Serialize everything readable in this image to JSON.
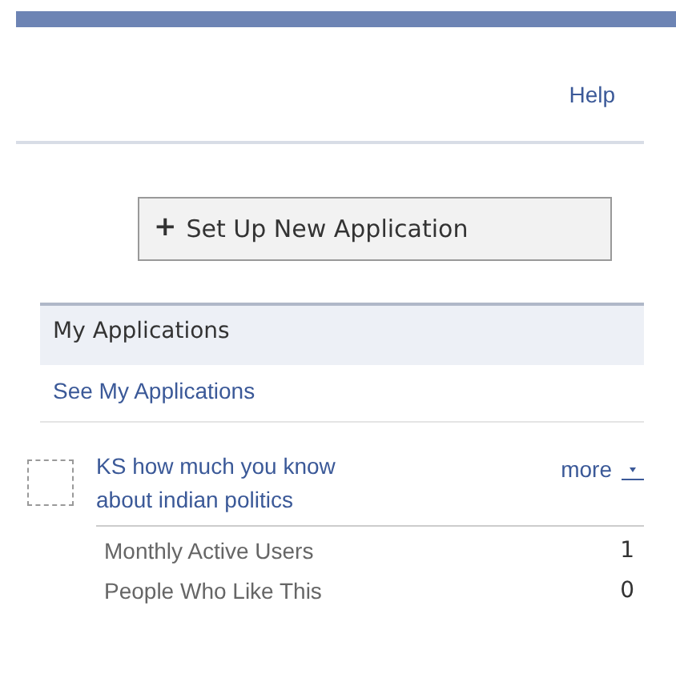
{
  "header_links": [
    "Help"
  ],
  "new_app_button": {
    "icon": "+",
    "label": "Set Up New Application"
  },
  "section": {
    "title": "My Applications",
    "link": "See My Applications"
  },
  "apps": [
    {
      "name": "KS how much you know about indian politics",
      "menu": "more",
      "stats": [
        {
          "label": "Monthly Active Users",
          "value": "1"
        },
        {
          "label": "People Who Like This",
          "value": "0"
        }
      ]
    }
  ]
}
